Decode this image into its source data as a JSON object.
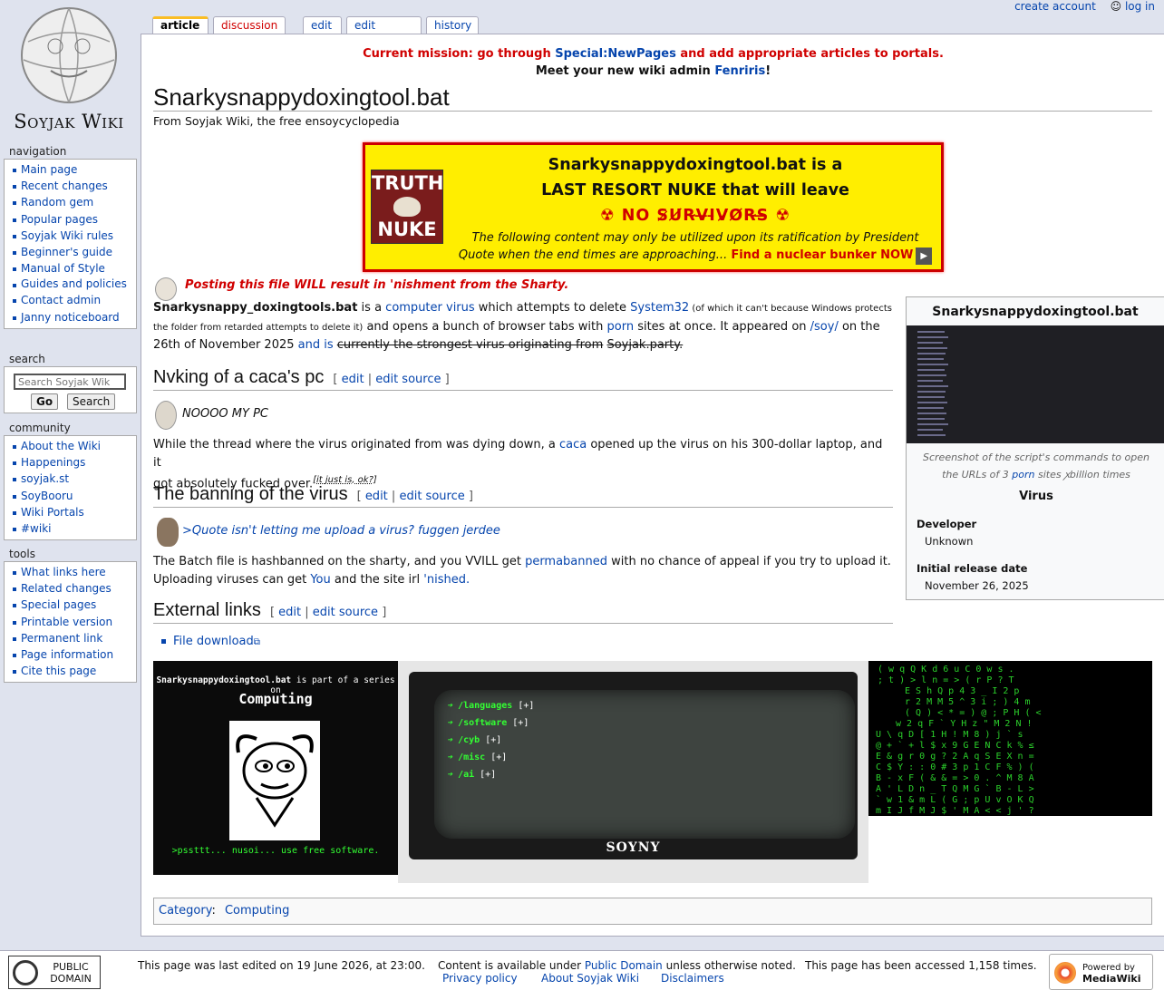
{
  "personal": {
    "create_account": "create account",
    "log_in": "log in"
  },
  "logo": {
    "wordmark": "Soyjak Wiki"
  },
  "tabs": {
    "article": "article",
    "discussion": "discussion",
    "edit": "edit",
    "edit_source": "edit source",
    "history": "history"
  },
  "nav": {
    "heading": "navigation",
    "items": [
      "Main page",
      "Recent changes",
      "Random gem",
      "Popular pages",
      "Soyjak Wiki rules",
      "Beginner's guide",
      "Manual of Style",
      "Guides and policies",
      "Contact admin",
      "Janny noticeboard"
    ]
  },
  "search": {
    "heading": "search",
    "placeholder": "Search Soyjak Wik",
    "go": "Go",
    "search": "Search"
  },
  "community": {
    "heading": "community",
    "items": [
      "About the Wiki",
      "Happenings",
      "soyjak.st",
      "SoyBooru",
      "Wiki Portals",
      "#wiki"
    ]
  },
  "tools": {
    "heading": "tools",
    "items": [
      "What links here",
      "Related changes",
      "Special pages",
      "Printable version",
      "Permanent link",
      "Page information",
      "Cite this page"
    ]
  },
  "notice": {
    "line1_a": "Current mission: go through ",
    "line1_link": "Special:NewPages",
    "line1_b": " and add appropriate articles to portals.",
    "line2_a": "Meet your new wiki admin ",
    "line2_link": "Fenriris",
    "line2_b": "!"
  },
  "page": {
    "title": "Snarkysnappydoxingtool.bat",
    "subtitle": "From Soyjak Wiki, the free ensoycyclopedia"
  },
  "nuke": {
    "img_top": "TRUTH",
    "img_bottom": "NUKE",
    "title_1": "Snarkysnappydoxingtool.bat is a",
    "title_2": "LAST RESORT NUKE that will leave",
    "title_3": "☢ NO S̷U̸R̴V̶I̵V̷O̸R̴S̶ ☢",
    "sub_1": "The following content may only be utilized upon its ratification by President",
    "sub_2": "Quote when the end times are approaching... ",
    "sub_link": "Find a nuclear bunker NOW",
    "play": "▶"
  },
  "warning": "Posting this file WILL result in 'nishment from the Sharty.",
  "intro": {
    "bold": "Snarkysnappy_doxingtools.bat",
    "t1": " is a ",
    "l1": "computer virus",
    "t2": " which attempts to delete ",
    "l2": "System32",
    "small": " (of which it can't because Windows protects",
    "small2": "the folder from retarded attempts to delete it)",
    "t3": " and opens a bunch of browser tabs with ",
    "l3": "porn",
    "t4": " sites at once. It appeared on ",
    "l4": "/soy/",
    "t5": " on the",
    "t6": "26th of November 2025 ",
    "l5": "and is ",
    "strike1": "currently the strongest virus originating from",
    "l6": " ",
    "strike2": "Soyjak.party."
  },
  "sections": {
    "s1": {
      "title": "Nvking of a caca's pc",
      "edit": "edit",
      "sep": "|",
      "edit_source": "edit source",
      "quote": "NOOOO MY PC",
      "p1_a": "While the thread where the virus originated from was dying down, a ",
      "p1_link": "caca",
      "p1_b": " opened up the virus on his 300-dollar laptop, and it",
      "p1_c": "got absolutely fucked over.",
      "p1_sup": "[it just is, ok?]"
    },
    "s2": {
      "title": "The banning of the virus",
      "edit": "edit",
      "sep": "|",
      "edit_source": "edit source",
      "quote": ">Quote isn't letting me upload a virus? fuggen jerdee",
      "p_a": "The Batch file is hashbanned on the sharty, and you VVILL get ",
      "p_link": "permabanned",
      "p_b": " with no chance of appeal if you try to upload it.",
      "p_c": "Uploading viruses can get ",
      "p_link2": "You",
      "p_d": " and the site irl ",
      "p_link3": "'nished."
    },
    "s3": {
      "title": "External links",
      "edit": "edit",
      "sep": "|",
      "edit_source": "edit source",
      "file_download": "File download"
    }
  },
  "infobox": {
    "title": "Snarkysnappydoxingtool.bat",
    "caption_a": "Screenshot of the script's commands to open",
    "caption_b": "the URLs of 3 ",
    "caption_link": "porn",
    "caption_c": " sites ꭗbillion times",
    "section": "Virus",
    "developer_label": "Developer",
    "developer": "Unknown",
    "release_label": "Initial release date",
    "release": "November 26, 2025"
  },
  "series": {
    "top_bold": "Snarkysnappydoxingtool.bat",
    "top_rest": " is part of a series on",
    "heading": "Computing",
    "bottom": ">pssttt... nusoi... use free software.",
    "menu": [
      "/languages",
      "/software",
      "/cyb",
      "/misc",
      "/ai"
    ],
    "menu_suffix": "[+]",
    "menu_arrow": "➔",
    "brand": "SOYNY"
  },
  "category": {
    "label": "Category",
    "colon": ":",
    "value": "Computing"
  },
  "footer": {
    "pd_1": "PUBLIC",
    "pd_2": "DOMAIN",
    "last_edited": "This page was last edited on 19 June 2026, at 23:00.",
    "content_a": "Content is available under ",
    "content_link": "Public Domain",
    "content_b": " unless otherwise noted.",
    "accessed": "This page has been accessed 1,158 times.",
    "privacy": "Privacy policy",
    "about": "About Soyjak Wiki",
    "disclaimers": "Disclaimers",
    "mw_1": "Powered by",
    "mw_2": "MediaWiki"
  },
  "colors": {
    "link": "#0645ad",
    "notice_red": "#d00000",
    "nuke_yellow": "#ffee00",
    "terminal_green": "#33ff33"
  }
}
